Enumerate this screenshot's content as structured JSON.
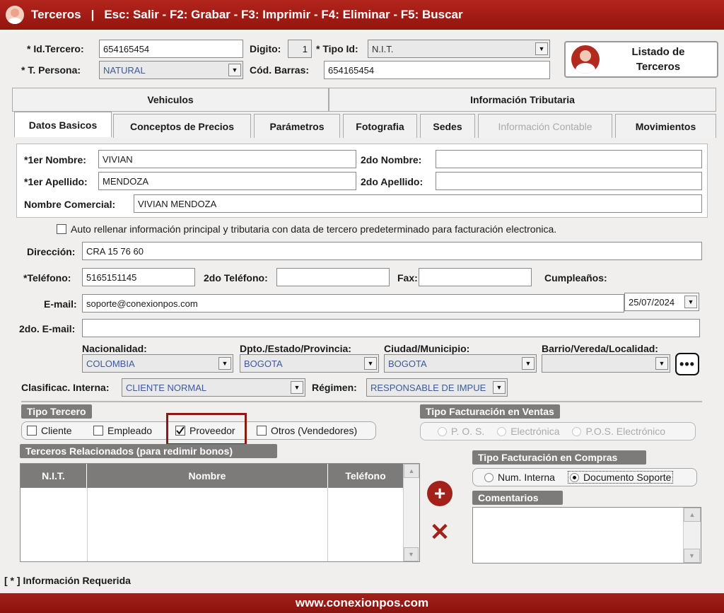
{
  "title": {
    "app": "Terceros",
    "sep": "|",
    "shortcuts": "Esc: Salir - F2: Grabar - F3: Imprimir - F4: Eliminar - F5: Buscar"
  },
  "header": {
    "id_label": "* Id.Tercero:",
    "id_value": "654165454",
    "digito_label": "Digito:",
    "digito_value": "1",
    "tipoid_label": "* Tipo Id:",
    "tipoid_value": "N.I.T.",
    "persona_label": "* T. Persona:",
    "persona_value": "NATURAL",
    "barras_label": "Cód. Barras:",
    "barras_value": "654165454",
    "listado_line1": "Listado de",
    "listado_line2": "Terceros"
  },
  "top_tabs": [
    "Vehiculos",
    "Información Tributaria"
  ],
  "tabs": [
    "Datos Basicos",
    "Conceptos de Precios",
    "Parámetros",
    "Fotografia",
    "Sedes",
    "Información Contable",
    "Movimientos"
  ],
  "names": {
    "nombre1_label": "*1er Nombre:",
    "nombre1_value": "VIVIAN",
    "nombre2_label": "2do Nombre:",
    "nombre2_value": "",
    "apellido1_label": "*1er Apellido:",
    "apellido1_value": "MENDOZA",
    "apellido2_label": "2do Apellido:",
    "apellido2_value": "",
    "comercial_label": "Nombre Comercial:",
    "comercial_value": "VIVIAN  MENDOZA"
  },
  "autofill_label": "Auto rellenar información principal y tributaria con data de tercero predeterminado para facturación electronica.",
  "contact": {
    "direccion_label": "Dirección:",
    "direccion_value": "CRA 15 76 60",
    "tel_label": "*Teléfono:",
    "tel_value": "5165151145",
    "tel2_label": "2do Teléfono:",
    "tel2_value": "",
    "fax_label": "Fax:",
    "fax_value": "",
    "cumple_label": "Cumpleaños:",
    "cumple_value": "25/07/2024",
    "email_label": "E-mail:",
    "email_value": "soporte@conexionpos.com",
    "email2_label": "2do. E-mail:",
    "email2_value": ""
  },
  "location": {
    "nac_label": "Nacionalidad:",
    "nac_value": "COLOMBIA",
    "dpto_label": "Dpto./Estado/Provincia:",
    "dpto_value": "BOGOTA",
    "ciudad_label": "Ciudad/Municipio:",
    "ciudad_value": "BOGOTA",
    "barrio_label": "Barrio/Vereda/Localidad:",
    "barrio_value": ""
  },
  "clasif": {
    "label": "Clasificac. Interna:",
    "value": "CLIENTE NORMAL",
    "regimen_label": "Régimen:",
    "regimen_value": "RESPONSABLE DE IMPUE"
  },
  "tipo_tercero": {
    "title": "Tipo Tercero",
    "options": [
      "Cliente",
      "Empleado",
      "Proveedor",
      "Otros (Vendedores)"
    ],
    "checked": "Proveedor"
  },
  "fact_ventas": {
    "title": "Tipo Facturación en Ventas",
    "options": [
      "P. O. S.",
      "Electrónica",
      "P.O.S. Electrónico"
    ]
  },
  "relacionados": {
    "title": "Terceros Relacionados (para redimir bonos)",
    "columns": [
      "N.I.T.",
      "Nombre",
      "Teléfono"
    ]
  },
  "fact_compras": {
    "title": "Tipo Facturación en Compras",
    "options": [
      "Num. Interna",
      "Documento Soporte"
    ],
    "selected": "Documento Soporte"
  },
  "comentarios": {
    "title": "Comentarios",
    "value": ""
  },
  "required_note": "[ * ] Información Requerida",
  "footer": "www.conexionpos.com",
  "colors": {
    "brand": "#9b1a13",
    "highlight": "#8b1a13",
    "group_bar": "#7c7b7a"
  }
}
